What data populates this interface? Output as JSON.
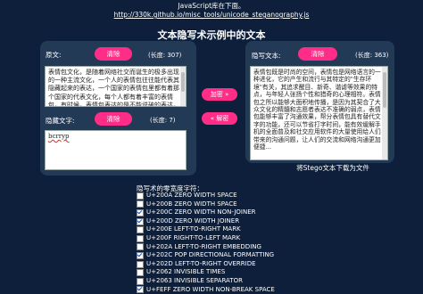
{
  "top": {
    "line1": "JavaScript库在下面。",
    "link": "http://330k.github.io/misc_tools/unicode_steganography.js"
  },
  "heading": "文本隐写术示例中的文本",
  "left": {
    "orig_label": "原文:",
    "clear1": "清除",
    "orig_len": "(长度: 307)",
    "orig_text": "表情包文化，是随着网络社交而诞生的极多出现的一种主流文化，一个人的表情包往往能代表其隐藏起来的表达，一个国家的表情包里都有着那个国家的代表文化，每个人都有着丰富的表情包，有时候，表情包表达的是不能说破的表达，语言中包含了文字的诸多元素的表达，图片中的表情包，表情包是一种视觉上的符号，网络语言也在不断的变化中...",
    "hidden_label": "隐藏文字:",
    "clear2": "清除",
    "hidden_len": "(长度: 7)",
    "hidden_text": "bcrryp"
  },
  "middle": {
    "encode": "加密 »",
    "decode": "« 解密"
  },
  "right": {
    "stego_label": "隐写文本:",
    "clear3": "清除",
    "stego_len": "(长度: 363)",
    "stego_text": "表情包既是时尚的空间，表情包是网络语言的一种进化，它的产生和流行与其特定的\"生存环境\"有关，其追求醒目、新奇、谐谑等效果的特点，与年轻人张扬个性和猎奇的心理相符。表情包之所以能够大面积地传播，是因为其契合了大众文化的精髓和志愿者表达不准确的弱点，表情包能够丰富了沟通效果，帮分表情包具有替代文字的功能，还可以节省打字时间，能有效缓解手机的全面普及和社交应用软件的大量使用给人们带来的沟通问题，让人们的交流和网络沟通更加便捷...",
    "download": "将Stego文本下载为文件"
  },
  "zw": {
    "title": "隐写术的零宽度字符：",
    "items": [
      {
        "label": "U+200A ZERO WIDTH SPACE",
        "checked": false
      },
      {
        "label": "U+200B ZERO WIDTH SPACE",
        "checked": false
      },
      {
        "label": "U+200C ZERO WIDTH NON-JOINER",
        "checked": true
      },
      {
        "label": "U+200D ZERO WIDTH JOINER",
        "checked": true
      },
      {
        "label": "U+200E LEFT-TO-RIGHT MARK",
        "checked": false
      },
      {
        "label": "U+200F RIGHT-TO-LEFT MARK",
        "checked": false
      },
      {
        "label": "U+202A LEFT-TO-RIGHT EMBEDDING",
        "checked": false
      },
      {
        "label": "U+202C POP DIRECTIONAL FORMATTING",
        "checked": true
      },
      {
        "label": "U+202D LEFT-TO-RIGHT OVERRIDE",
        "checked": false
      },
      {
        "label": "U+2062 INVISIBLE TIMES",
        "checked": false
      },
      {
        "label": "U+2063 INVISIBLE SEPARATOR",
        "checked": false
      },
      {
        "label": "U+FEFF ZERO WIDTH NON-BREAK SPACE",
        "checked": true
      }
    ]
  },
  "colors": {
    "bg": "#0d1f3a",
    "panel": "#233a57",
    "accent": "#ff2d87"
  }
}
